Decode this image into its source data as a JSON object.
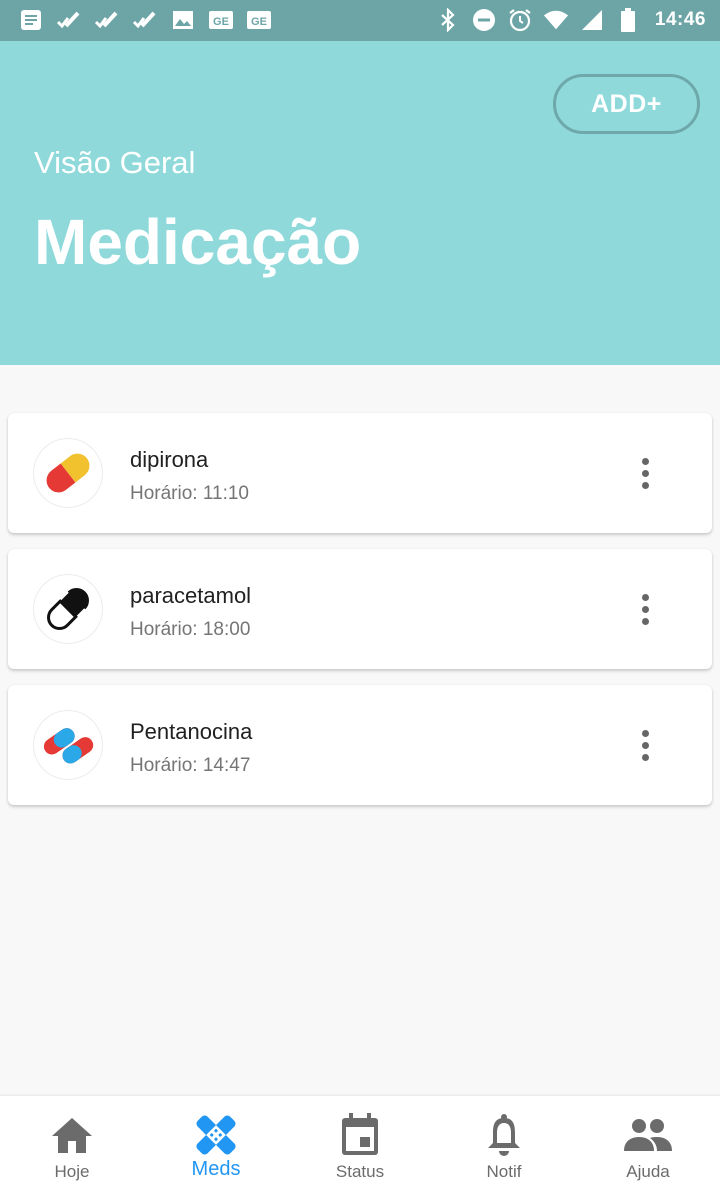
{
  "status_bar": {
    "time": "14:46",
    "left_icons": [
      "message-icon",
      "check-icon",
      "check-icon",
      "check-icon",
      "image-icon",
      "ge-icon",
      "ge-icon"
    ],
    "right_icons": [
      "bluetooth-icon",
      "dnd-icon",
      "alarm-icon",
      "wifi-icon",
      "signal-icon",
      "battery-icon"
    ]
  },
  "header": {
    "add_label": "ADD+",
    "subtitle": "Visão Geral",
    "title": "Medicação"
  },
  "medications": [
    {
      "name": "dipirona",
      "time": "Horário: 11:10",
      "icon": "pill-yellow-red-icon"
    },
    {
      "name": "paracetamol",
      "time": "Horário: 18:00",
      "icon": "pill-black-white-icon"
    },
    {
      "name": "Pentanocina",
      "time": "Horário: 14:47",
      "icon": "pills-blue-red-icon"
    }
  ],
  "nav": [
    {
      "label": "Hoje",
      "icon": "home-icon",
      "active": false
    },
    {
      "label": "Meds",
      "icon": "bandage-icon",
      "active": true
    },
    {
      "label": "Status",
      "icon": "calendar-icon",
      "active": false
    },
    {
      "label": "Notif",
      "icon": "bell-icon",
      "active": false
    },
    {
      "label": "Ajuda",
      "icon": "people-icon",
      "active": false
    }
  ],
  "colors": {
    "header_bg": "#8fd9db",
    "status_bar_bg": "#6da5a7",
    "active_nav": "#2196f3"
  }
}
